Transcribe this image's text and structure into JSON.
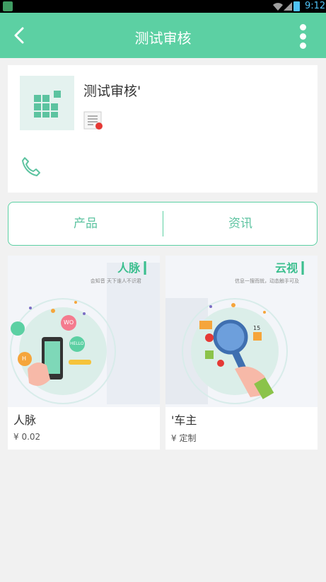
{
  "status_bar": {
    "time": "9:12"
  },
  "app_bar": {
    "title": "测试审核"
  },
  "profile": {
    "name": "测试审核'"
  },
  "tabs": [
    {
      "label": "产品"
    },
    {
      "label": "资讯"
    }
  ],
  "products": [
    {
      "name": "人脉",
      "price": "¥ 0.02",
      "brand": "人脉 ▎",
      "slogan": "会知音   天下谁人不识君",
      "bubble1": "WO",
      "bubble2": "HELLO",
      "bubble3": "H"
    },
    {
      "name": "'车主",
      "price": "¥ 定制",
      "brand": "云视 ▎",
      "slogan": "信息一搜而就，动态触手可及",
      "badge": "15"
    }
  ],
  "colors": {
    "accent": "#5cd0a3",
    "accent_text": "#5cc3a0",
    "background": "#f1f1f1"
  }
}
